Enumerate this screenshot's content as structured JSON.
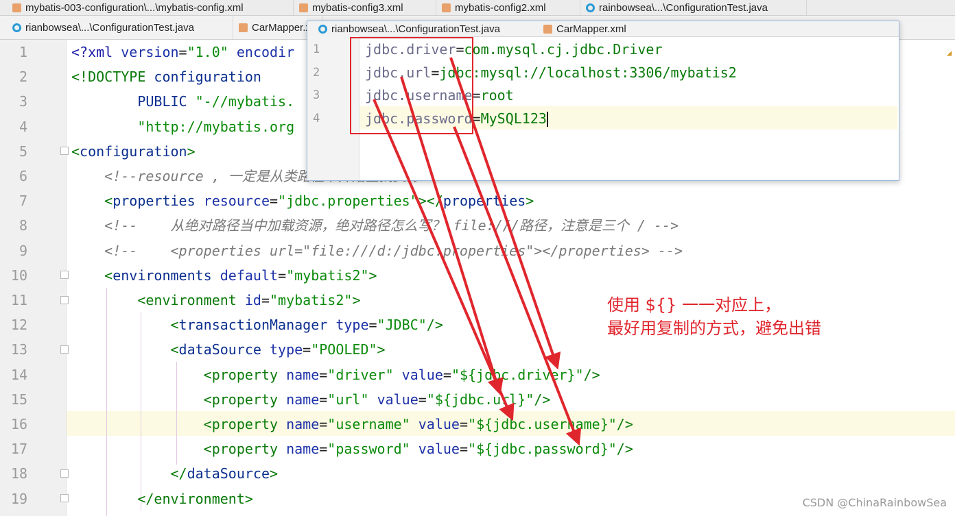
{
  "tabs_row1": [
    {
      "icon": "xml-file-icon",
      "label": "mybatis-003-configuration\\...\\mybatis-config.xml"
    },
    {
      "icon": "xml-file-icon",
      "label": "mybatis-config3.xml"
    },
    {
      "icon": "xml-file-icon",
      "label": "mybatis-config2.xml"
    },
    {
      "icon": "java-class-icon",
      "label": "rainbowsea\\...\\ConfigurationTest.java"
    }
  ],
  "tabs_row2": [
    {
      "icon": "java-class-icon",
      "label": "rianbowsea\\...\\ConfigurationTest.java"
    },
    {
      "icon": "xml-file-icon",
      "label": "CarMapper.xml"
    }
  ],
  "popup_tabs": [
    {
      "icon": "java-class-icon",
      "label": "rianbowsea\\...\\ConfigurationTest.java"
    },
    {
      "icon": "xml-file-icon",
      "label": "CarMapper.xml"
    }
  ],
  "popup_lines": [
    {
      "num": "1",
      "key": "jdbc.driver",
      "eq": "=",
      "value": "com.mysql.cj.jdbc.Driver"
    },
    {
      "num": "2",
      "key": "jdbc.url",
      "eq": "=",
      "value": "jdbc:mysql://localhost:3306/mybatis2"
    },
    {
      "num": "3",
      "key": "jdbc.username",
      "eq": "=",
      "value": "root"
    },
    {
      "num": "4",
      "key": "jdbc.password",
      "eq": "=",
      "value": "MySQL123"
    }
  ],
  "lines": [
    {
      "num": "1",
      "t": [
        [
          "t-pi",
          "<?xml "
        ],
        [
          "t-attr",
          "version"
        ],
        [
          "t-pl",
          "="
        ],
        [
          "t-val",
          "\"1.0\""
        ],
        [
          "t-pl",
          " "
        ],
        [
          "t-attr",
          "encodir"
        ]
      ]
    },
    {
      "num": "2",
      "t": [
        [
          "t-tagg",
          "<!DOCTYPE "
        ],
        [
          "t-tag",
          "configuration"
        ]
      ]
    },
    {
      "num": "3",
      "t": [
        [
          "t-pl",
          "        "
        ],
        [
          "t-tag",
          "PUBLIC "
        ],
        [
          "t-val",
          "\"-//mybatis."
        ]
      ]
    },
    {
      "num": "4",
      "t": [
        [
          "t-pl",
          "        "
        ],
        [
          "t-val",
          "\"http://mybatis.org"
        ]
      ]
    },
    {
      "num": "5",
      "t": [
        [
          "t-tagg",
          "<"
        ],
        [
          "t-tag",
          "configuration"
        ],
        [
          "t-tagg",
          ">"
        ]
      ]
    },
    {
      "num": "6",
      "t": [
        [
          "t-pl",
          "    "
        ],
        [
          "t-com",
          "<!--resource , 一定是从类路径下开始查找资源 -->"
        ]
      ]
    },
    {
      "num": "7",
      "t": [
        [
          "t-pl",
          "    "
        ],
        [
          "t-tagg",
          "<"
        ],
        [
          "t-tag",
          "properties "
        ],
        [
          "t-attr",
          "resource"
        ],
        [
          "t-pl",
          "="
        ],
        [
          "t-val",
          "\"jdbc.properties\""
        ],
        [
          "t-tagg",
          "></"
        ],
        [
          "t-tag",
          "properties"
        ],
        [
          "t-tagg",
          ">"
        ]
      ]
    },
    {
      "num": "8",
      "t": [
        [
          "t-pl",
          "    "
        ],
        [
          "t-com",
          "<!--    从绝对路径当中加载资源，绝对路径怎么写？ file:///路径，注意是三个 / -->"
        ]
      ]
    },
    {
      "num": "9",
      "t": [
        [
          "t-pl",
          "    "
        ],
        [
          "t-com",
          "<!--    <properties url=\"file:///d:/jdbc.properties\"></properties> -->"
        ]
      ]
    },
    {
      "num": "10",
      "t": [
        [
          "t-pl",
          "    "
        ],
        [
          "t-tagg",
          "<"
        ],
        [
          "t-tag",
          "environments "
        ],
        [
          "t-attr",
          "default"
        ],
        [
          "t-pl",
          "="
        ],
        [
          "t-val",
          "\"mybatis2\""
        ],
        [
          "t-tagg",
          ">"
        ]
      ]
    },
    {
      "num": "11",
      "t": [
        [
          "t-pl",
          "        "
        ],
        [
          "t-tagg",
          "<environment "
        ],
        [
          "t-attr",
          "id"
        ],
        [
          "t-pl",
          "="
        ],
        [
          "t-val",
          "\"mybatis2\""
        ],
        [
          "t-tagg",
          ">"
        ]
      ]
    },
    {
      "num": "12",
      "t": [
        [
          "t-pl",
          "            "
        ],
        [
          "t-tagg",
          "<"
        ],
        [
          "t-tag",
          "transactionManager "
        ],
        [
          "t-attr",
          "type"
        ],
        [
          "t-pl",
          "="
        ],
        [
          "t-val",
          "\"JDBC\""
        ],
        [
          "t-tagg",
          "/>"
        ]
      ]
    },
    {
      "num": "13",
      "t": [
        [
          "t-pl",
          "            "
        ],
        [
          "t-tagg",
          "<"
        ],
        [
          "t-tag",
          "dataSource "
        ],
        [
          "t-attr",
          "type"
        ],
        [
          "t-pl",
          "="
        ],
        [
          "t-val",
          "\"POOLED\""
        ],
        [
          "t-tagg",
          ">"
        ]
      ]
    },
    {
      "num": "14",
      "t": [
        [
          "t-pl",
          "                "
        ],
        [
          "t-tagg",
          "<property "
        ],
        [
          "t-attr",
          "name"
        ],
        [
          "t-pl",
          "="
        ],
        [
          "t-val",
          "\"driver\""
        ],
        [
          "t-pl",
          " "
        ],
        [
          "t-attr",
          "value"
        ],
        [
          "t-pl",
          "="
        ],
        [
          "t-val",
          "\"${jdbc.driver}\""
        ],
        [
          "t-tagg",
          "/>"
        ]
      ]
    },
    {
      "num": "15",
      "t": [
        [
          "t-pl",
          "                "
        ],
        [
          "t-tagg",
          "<property "
        ],
        [
          "t-attr",
          "name"
        ],
        [
          "t-pl",
          "="
        ],
        [
          "t-val",
          "\"url\""
        ],
        [
          "t-pl",
          " "
        ],
        [
          "t-attr",
          "value"
        ],
        [
          "t-pl",
          "="
        ],
        [
          "t-val",
          "\"${jdbc.url}\""
        ],
        [
          "t-tagg",
          "/>"
        ]
      ]
    },
    {
      "num": "16",
      "t": [
        [
          "t-pl",
          "                "
        ],
        [
          "t-tagg",
          "<property "
        ],
        [
          "t-attr",
          "name"
        ],
        [
          "t-pl",
          "="
        ],
        [
          "t-val",
          "\"username\""
        ],
        [
          "t-pl",
          " "
        ],
        [
          "t-attr",
          "value"
        ],
        [
          "t-pl",
          "="
        ],
        [
          "t-val",
          "\"${jdbc.username}\""
        ],
        [
          "t-tagg",
          "/>"
        ]
      ]
    },
    {
      "num": "17",
      "t": [
        [
          "t-pl",
          "                "
        ],
        [
          "t-tagg",
          "<property "
        ],
        [
          "t-attr",
          "name"
        ],
        [
          "t-pl",
          "="
        ],
        [
          "t-val",
          "\"password\""
        ],
        [
          "t-pl",
          " "
        ],
        [
          "t-attr",
          "value"
        ],
        [
          "t-pl",
          "="
        ],
        [
          "t-val",
          "\"${jdbc.password}\""
        ],
        [
          "t-tagg",
          "/>"
        ]
      ]
    },
    {
      "num": "18",
      "t": [
        [
          "t-pl",
          "            "
        ],
        [
          "t-tagg",
          "</"
        ],
        [
          "t-tag",
          "dataSource"
        ],
        [
          "t-tagg",
          ">"
        ]
      ]
    },
    {
      "num": "19",
      "t": [
        [
          "t-pl",
          "        "
        ],
        [
          "t-tagg",
          "</environment>"
        ]
      ]
    }
  ],
  "annotation": "使用 ${} 一一对应上，\n最好用复制的方式，避免出错",
  "watermark": "CSDN @ChinaRainbowSea",
  "colors": {
    "annotation": "#e0262d",
    "xml_tag": "#0b2f8f",
    "xml_value": "#0a8a0a",
    "comment": "#7a7a7a"
  }
}
